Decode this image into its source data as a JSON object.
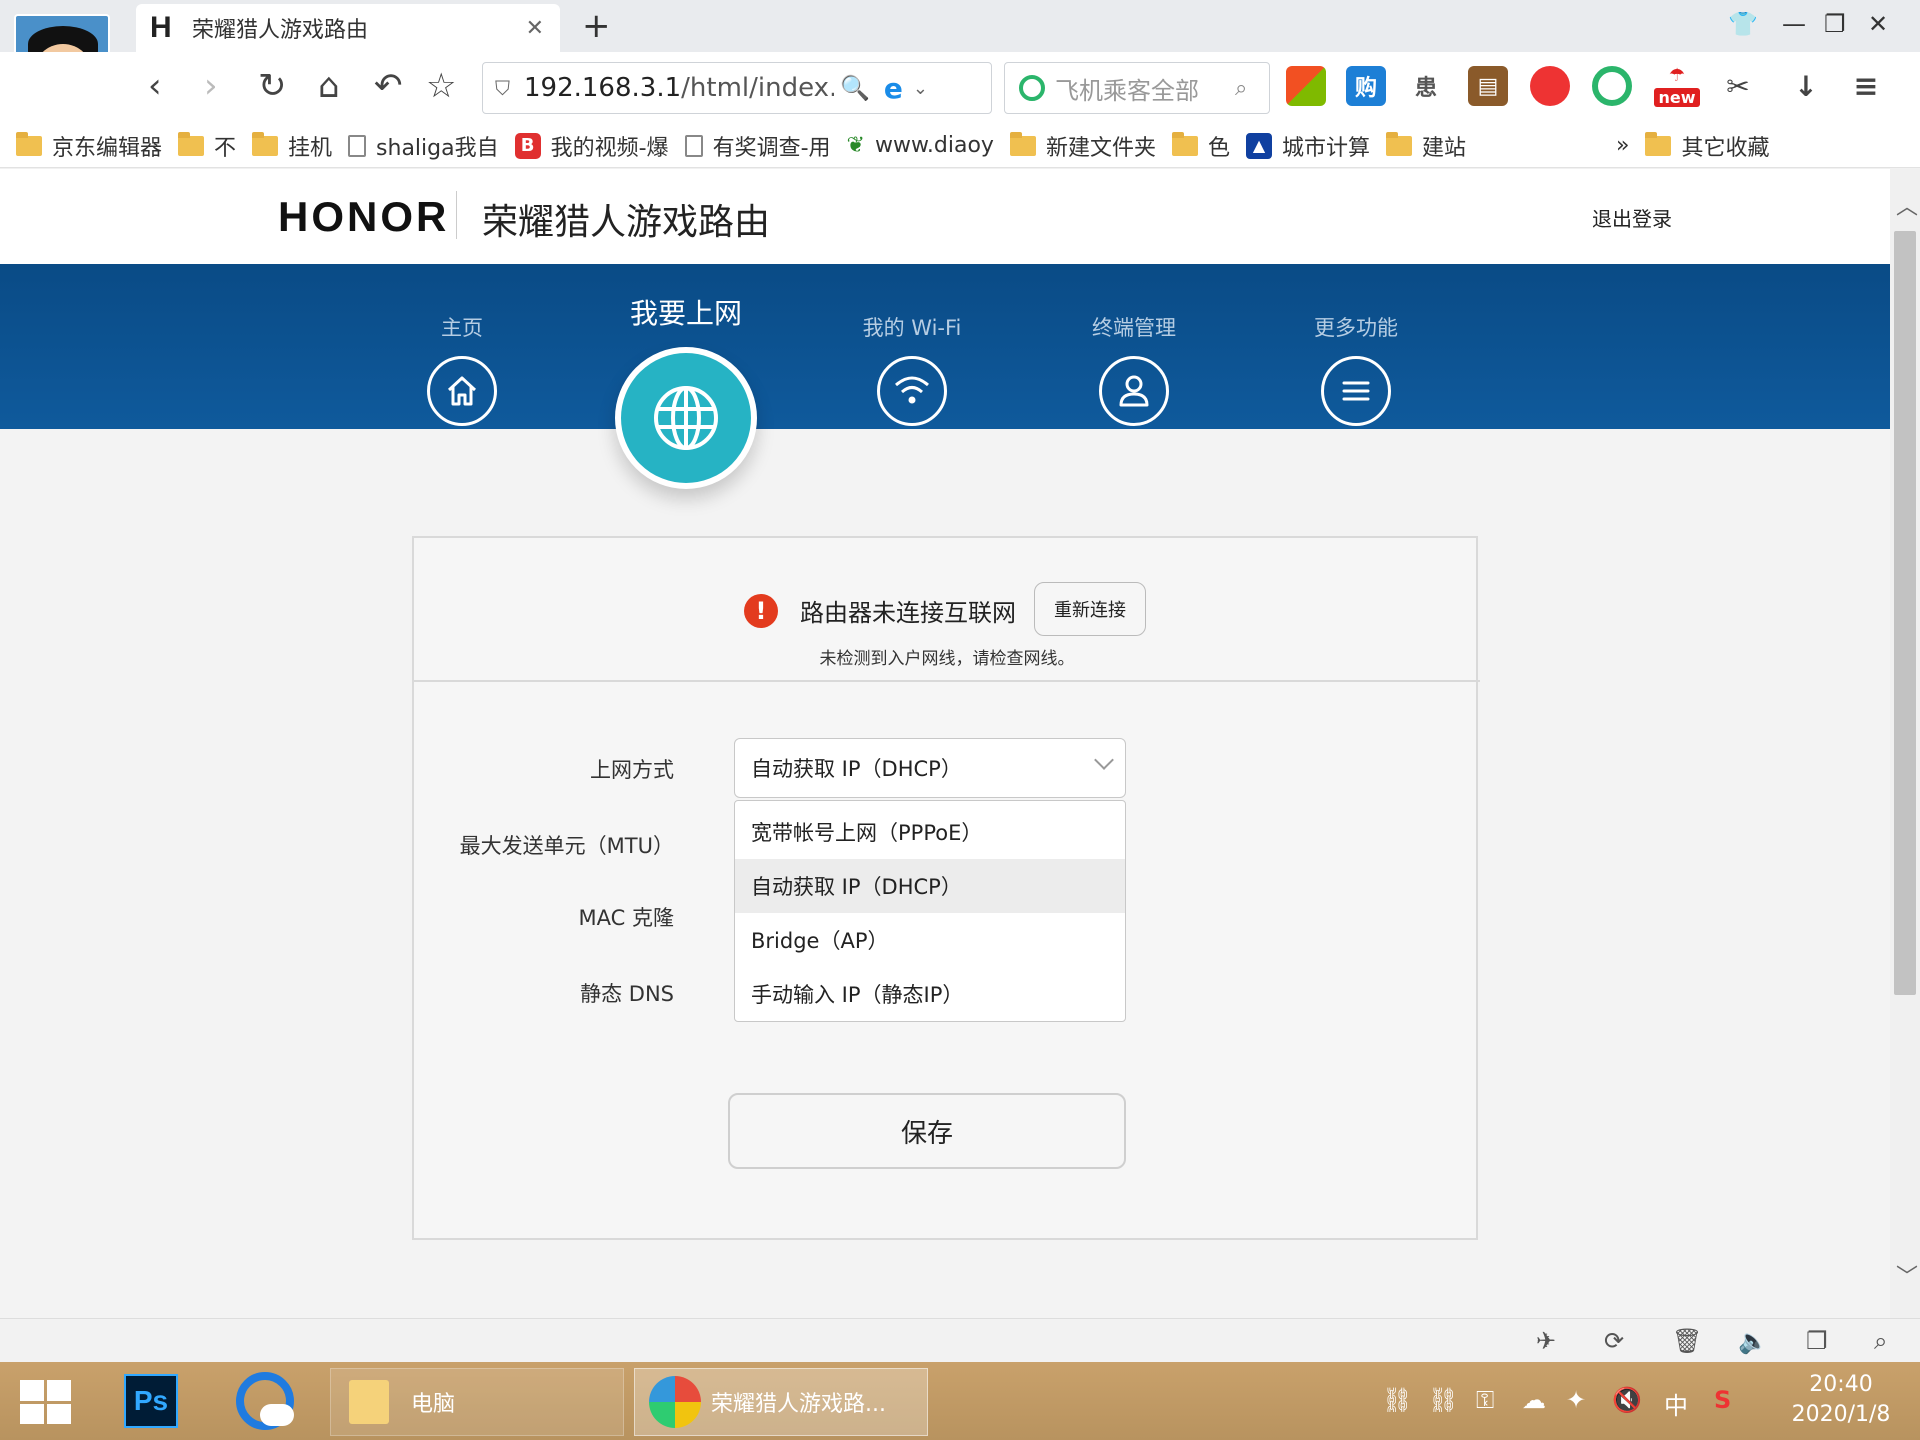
{
  "browser": {
    "tab_title": "荣耀猎人游戏路由",
    "tab_favicon": "H",
    "new_tab": "+",
    "url_host": "192.168.3.1",
    "url_path": "/html/index.",
    "search_placeholder": "飞机乘客全部",
    "ext_new_badge": "new",
    "bookmarks": [
      {
        "icon": "folder",
        "label": "京东编辑器"
      },
      {
        "icon": "folder",
        "label": "不"
      },
      {
        "icon": "folder",
        "label": "挂机"
      },
      {
        "icon": "page",
        "label": "shaliga我自"
      },
      {
        "icon": "red-app",
        "label": "我的视频-爆"
      },
      {
        "icon": "page",
        "label": "有奖调查-用"
      },
      {
        "icon": "leaf",
        "label": "www.diaoy"
      },
      {
        "icon": "folder",
        "label": "新建文件夹"
      },
      {
        "icon": "folder",
        "label": "色"
      },
      {
        "icon": "blue-app",
        "label": "城市计算"
      },
      {
        "icon": "folder",
        "label": "建站"
      }
    ],
    "bookmarks_more": "»",
    "bookmarks_other": "其它收藏"
  },
  "header": {
    "brand": "HONOR",
    "title": "荣耀猎人游戏路由",
    "logout": "退出登录"
  },
  "nav": {
    "items": [
      {
        "label": "主页",
        "icon": "home-icon"
      },
      {
        "label": "我要上网",
        "icon": "globe-icon",
        "active": true
      },
      {
        "label": "我的 Wi-Fi",
        "icon": "wifi-icon"
      },
      {
        "label": "终端管理",
        "icon": "user-icon"
      },
      {
        "label": "更多功能",
        "icon": "menu-icon"
      }
    ]
  },
  "status": {
    "message": "路由器未连接互联网",
    "reconnect": "重新连接",
    "hint": "未检测到入户网线，请检查网线。"
  },
  "form": {
    "labels": {
      "mode": "上网方式",
      "mtu": "最大发送单元（MTU）",
      "mac": "MAC 克隆",
      "dns": "静态 DNS"
    },
    "selected": "自动获取 IP（DHCP）",
    "options": [
      "宽带帐号上网（PPPoE）",
      "自动获取 IP（DHCP）",
      "Bridge（AP）",
      "手动输入 IP（静态IP）"
    ],
    "save": "保存"
  },
  "taskbar": {
    "ps_label": "Ps",
    "explorer": "电脑",
    "browser": "荣耀猎人游戏路...",
    "ime": "中",
    "time": "20:40",
    "date": "2020/1/8"
  },
  "colors": {
    "nav_band": "#0f5a9c",
    "active_circle": "#26b3c4",
    "error": "#e33b1e"
  }
}
